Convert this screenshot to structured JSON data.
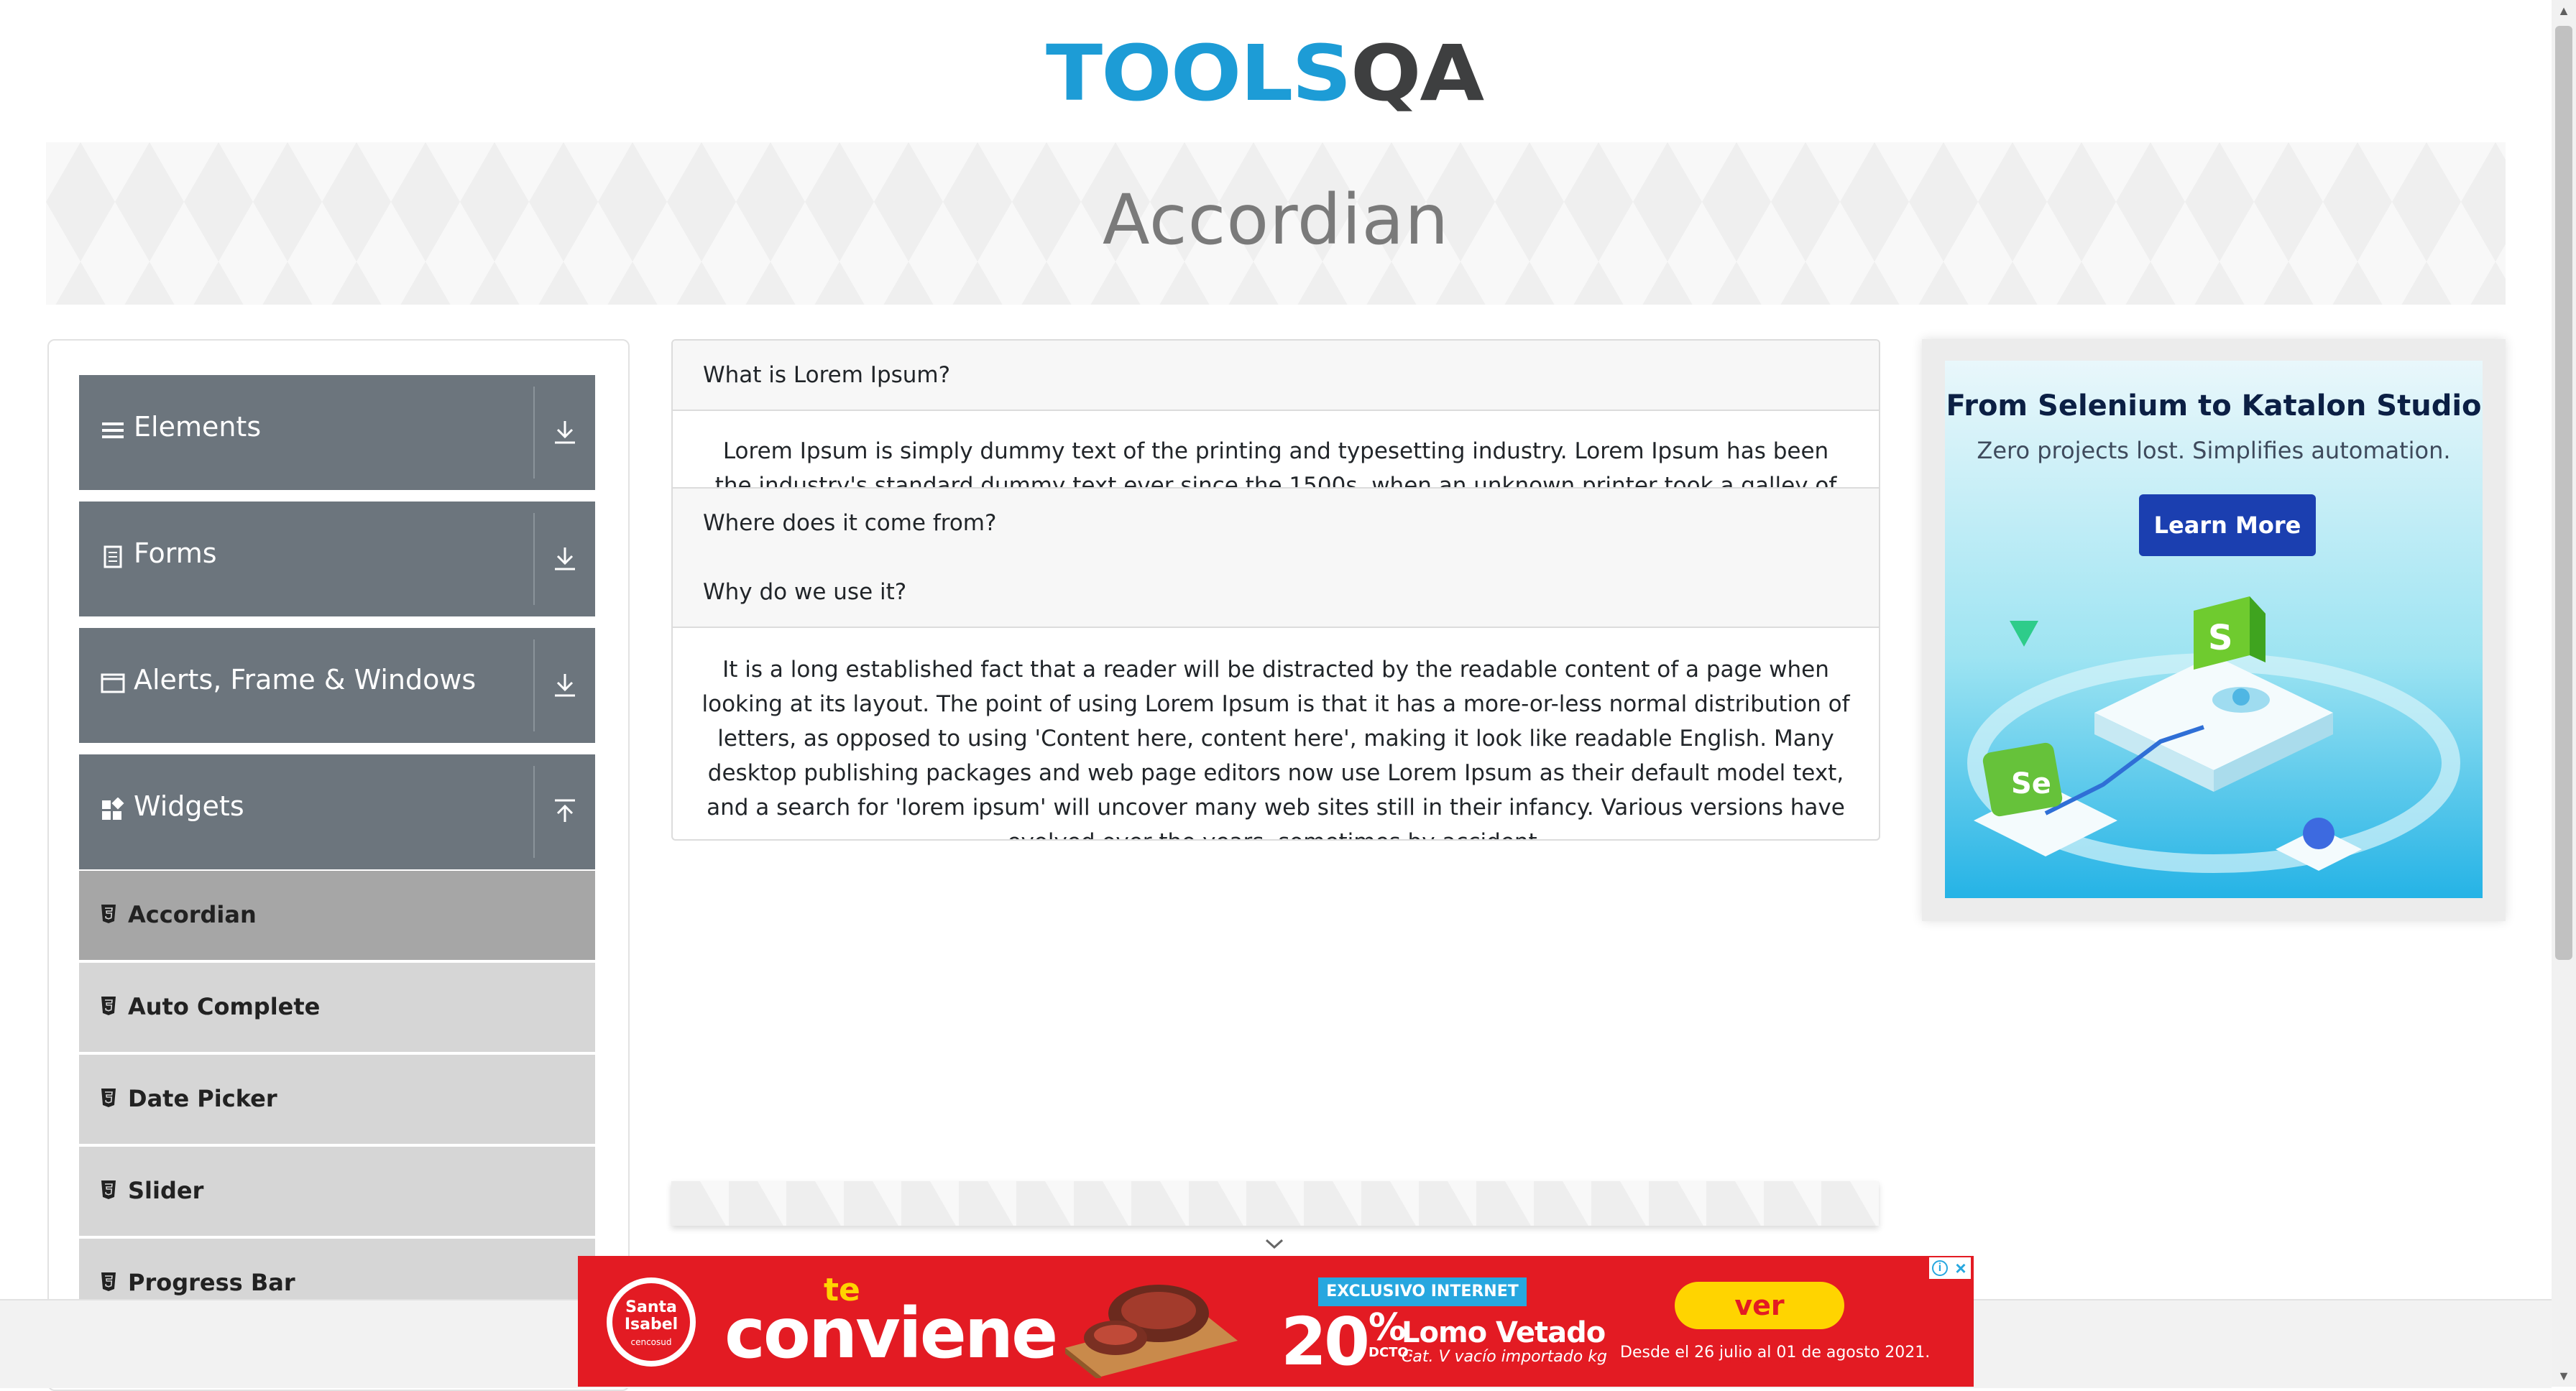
{
  "header": {
    "logo_part1": "TOOLS",
    "logo_part2": "QA"
  },
  "banner": {
    "title": "Accordian"
  },
  "sidebar": {
    "groups": [
      {
        "label": "Elements",
        "icon": "hamburger-icon",
        "toggle_icon": "download-arrow-icon"
      },
      {
        "label": "Forms",
        "icon": "document-icon",
        "toggle_icon": "download-arrow-icon"
      },
      {
        "label": "Alerts, Frame & Windows",
        "icon": "window-icon",
        "toggle_icon": "download-arrow-icon"
      },
      {
        "label": "Widgets",
        "icon": "widgets-icon",
        "toggle_icon": "upload-arrow-icon"
      }
    ],
    "widget_items": [
      {
        "label": "Accordian",
        "active": true
      },
      {
        "label": "Auto Complete"
      },
      {
        "label": "Date Picker"
      },
      {
        "label": "Slider"
      },
      {
        "label": "Progress Bar"
      }
    ],
    "colors": {
      "group_bg": "#6c757d",
      "item_bg": "#d6d6d6",
      "active_bg": "#a6a6a6"
    }
  },
  "accordion": {
    "sections": [
      {
        "heading": "What is Lorem Ipsum?",
        "body": "Lorem Ipsum is simply dummy text of the printing and typesetting industry. Lorem Ipsum has been the industry's standard dummy text ever since the 1500s, when an unknown printer took a galley of type and scrambled it to"
      },
      {
        "heading": "Where does it come from?"
      },
      {
        "heading": "Why do we use it?",
        "body": "It is a long established fact that a reader will be distracted by the readable content of a page when looking at its layout. The point of using Lorem Ipsum is that it has a more-or-less normal distribution of letters, as opposed to using 'Content here, content here', making it look like readable English. Many desktop publishing packages and web page editors now use Lorem Ipsum as their default model text, and a search for 'lorem ipsum' will uncover many web sites still in their infancy. Various versions have evolved over the years, sometimes by accident,"
      }
    ]
  },
  "right_ad": {
    "title": "From Selenium to Katalon Studio",
    "subtitle": "Zero projects lost. Simplifies automation.",
    "button": "Learn More",
    "badge_s": "S",
    "badge_se": "Se"
  },
  "bottom_ad": {
    "brand_line1": "Santa",
    "brand_line2": "Isabel",
    "brand_line3": "cencosud",
    "te": "te",
    "conviene": "conviene",
    "exclusive": "EXCLUSIVO INTERNET",
    "percent": "20",
    "percent_sign": "%",
    "dcto": "DCTO.",
    "product": "Lomo Vetado",
    "product_note": "Cat. V vacío importado kg",
    "cta": "ver ofertas",
    "dates": "Desde el 26 julio al 01 de agosto 2021."
  }
}
